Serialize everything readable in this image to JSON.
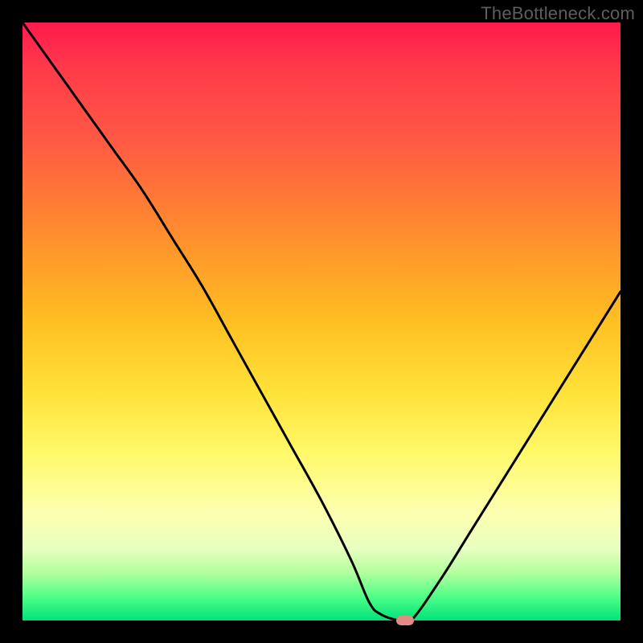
{
  "watermark": "TheBottleneck.com",
  "chart_data": {
    "type": "line",
    "title": "",
    "xlabel": "",
    "ylabel": "",
    "xlim": [
      0,
      100
    ],
    "ylim": [
      0,
      100
    ],
    "grid": false,
    "background": "rainbow-vertical-gradient",
    "series": [
      {
        "name": "bottleneck-curve",
        "x": [
          0,
          5,
          10,
          15,
          20,
          25,
          30,
          35,
          40,
          45,
          50,
          55,
          58,
          60,
          63,
          65,
          70,
          75,
          80,
          85,
          90,
          95,
          100
        ],
        "values": [
          100,
          93,
          86,
          79,
          72,
          64,
          56,
          47,
          38,
          29,
          20,
          10,
          3,
          1,
          0,
          0,
          7,
          15,
          23,
          31,
          39,
          47,
          55
        ]
      }
    ],
    "marker": {
      "x": 64,
      "y": 0,
      "color": "#e08b84"
    }
  }
}
